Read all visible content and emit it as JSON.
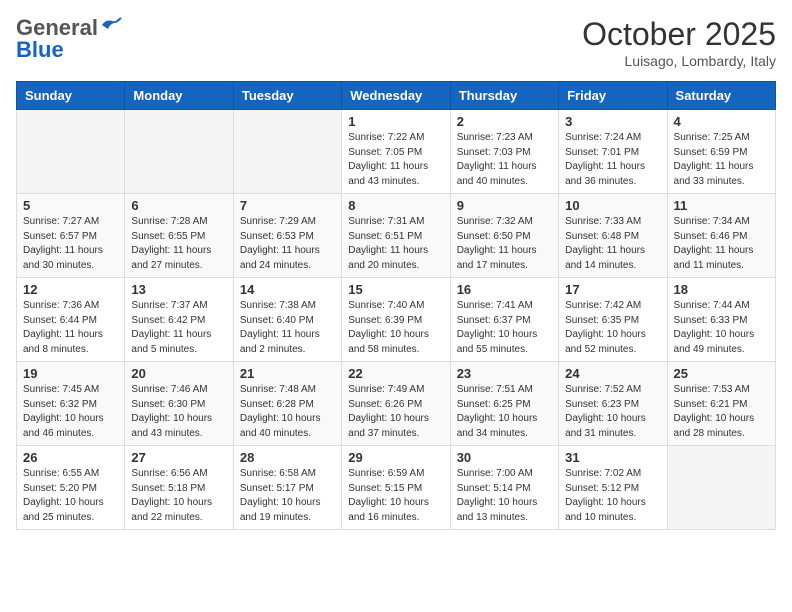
{
  "logo": {
    "general": "General",
    "blue": "Blue"
  },
  "header": {
    "month": "October 2025",
    "location": "Luisago, Lombardy, Italy"
  },
  "days_of_week": [
    "Sunday",
    "Monday",
    "Tuesday",
    "Wednesday",
    "Thursday",
    "Friday",
    "Saturday"
  ],
  "weeks": [
    [
      {
        "day": "",
        "info": ""
      },
      {
        "day": "",
        "info": ""
      },
      {
        "day": "",
        "info": ""
      },
      {
        "day": "1",
        "info": "Sunrise: 7:22 AM\nSunset: 7:05 PM\nDaylight: 11 hours and 43 minutes."
      },
      {
        "day": "2",
        "info": "Sunrise: 7:23 AM\nSunset: 7:03 PM\nDaylight: 11 hours and 40 minutes."
      },
      {
        "day": "3",
        "info": "Sunrise: 7:24 AM\nSunset: 7:01 PM\nDaylight: 11 hours and 36 minutes."
      },
      {
        "day": "4",
        "info": "Sunrise: 7:25 AM\nSunset: 6:59 PM\nDaylight: 11 hours and 33 minutes."
      }
    ],
    [
      {
        "day": "5",
        "info": "Sunrise: 7:27 AM\nSunset: 6:57 PM\nDaylight: 11 hours and 30 minutes."
      },
      {
        "day": "6",
        "info": "Sunrise: 7:28 AM\nSunset: 6:55 PM\nDaylight: 11 hours and 27 minutes."
      },
      {
        "day": "7",
        "info": "Sunrise: 7:29 AM\nSunset: 6:53 PM\nDaylight: 11 hours and 24 minutes."
      },
      {
        "day": "8",
        "info": "Sunrise: 7:31 AM\nSunset: 6:51 PM\nDaylight: 11 hours and 20 minutes."
      },
      {
        "day": "9",
        "info": "Sunrise: 7:32 AM\nSunset: 6:50 PM\nDaylight: 11 hours and 17 minutes."
      },
      {
        "day": "10",
        "info": "Sunrise: 7:33 AM\nSunset: 6:48 PM\nDaylight: 11 hours and 14 minutes."
      },
      {
        "day": "11",
        "info": "Sunrise: 7:34 AM\nSunset: 6:46 PM\nDaylight: 11 hours and 11 minutes."
      }
    ],
    [
      {
        "day": "12",
        "info": "Sunrise: 7:36 AM\nSunset: 6:44 PM\nDaylight: 11 hours and 8 minutes."
      },
      {
        "day": "13",
        "info": "Sunrise: 7:37 AM\nSunset: 6:42 PM\nDaylight: 11 hours and 5 minutes."
      },
      {
        "day": "14",
        "info": "Sunrise: 7:38 AM\nSunset: 6:40 PM\nDaylight: 11 hours and 2 minutes."
      },
      {
        "day": "15",
        "info": "Sunrise: 7:40 AM\nSunset: 6:39 PM\nDaylight: 10 hours and 58 minutes."
      },
      {
        "day": "16",
        "info": "Sunrise: 7:41 AM\nSunset: 6:37 PM\nDaylight: 10 hours and 55 minutes."
      },
      {
        "day": "17",
        "info": "Sunrise: 7:42 AM\nSunset: 6:35 PM\nDaylight: 10 hours and 52 minutes."
      },
      {
        "day": "18",
        "info": "Sunrise: 7:44 AM\nSunset: 6:33 PM\nDaylight: 10 hours and 49 minutes."
      }
    ],
    [
      {
        "day": "19",
        "info": "Sunrise: 7:45 AM\nSunset: 6:32 PM\nDaylight: 10 hours and 46 minutes."
      },
      {
        "day": "20",
        "info": "Sunrise: 7:46 AM\nSunset: 6:30 PM\nDaylight: 10 hours and 43 minutes."
      },
      {
        "day": "21",
        "info": "Sunrise: 7:48 AM\nSunset: 6:28 PM\nDaylight: 10 hours and 40 minutes."
      },
      {
        "day": "22",
        "info": "Sunrise: 7:49 AM\nSunset: 6:26 PM\nDaylight: 10 hours and 37 minutes."
      },
      {
        "day": "23",
        "info": "Sunrise: 7:51 AM\nSunset: 6:25 PM\nDaylight: 10 hours and 34 minutes."
      },
      {
        "day": "24",
        "info": "Sunrise: 7:52 AM\nSunset: 6:23 PM\nDaylight: 10 hours and 31 minutes."
      },
      {
        "day": "25",
        "info": "Sunrise: 7:53 AM\nSunset: 6:21 PM\nDaylight: 10 hours and 28 minutes."
      }
    ],
    [
      {
        "day": "26",
        "info": "Sunrise: 6:55 AM\nSunset: 5:20 PM\nDaylight: 10 hours and 25 minutes."
      },
      {
        "day": "27",
        "info": "Sunrise: 6:56 AM\nSunset: 5:18 PM\nDaylight: 10 hours and 22 minutes."
      },
      {
        "day": "28",
        "info": "Sunrise: 6:58 AM\nSunset: 5:17 PM\nDaylight: 10 hours and 19 minutes."
      },
      {
        "day": "29",
        "info": "Sunrise: 6:59 AM\nSunset: 5:15 PM\nDaylight: 10 hours and 16 minutes."
      },
      {
        "day": "30",
        "info": "Sunrise: 7:00 AM\nSunset: 5:14 PM\nDaylight: 10 hours and 13 minutes."
      },
      {
        "day": "31",
        "info": "Sunrise: 7:02 AM\nSunset: 5:12 PM\nDaylight: 10 hours and 10 minutes."
      },
      {
        "day": "",
        "info": ""
      }
    ]
  ]
}
